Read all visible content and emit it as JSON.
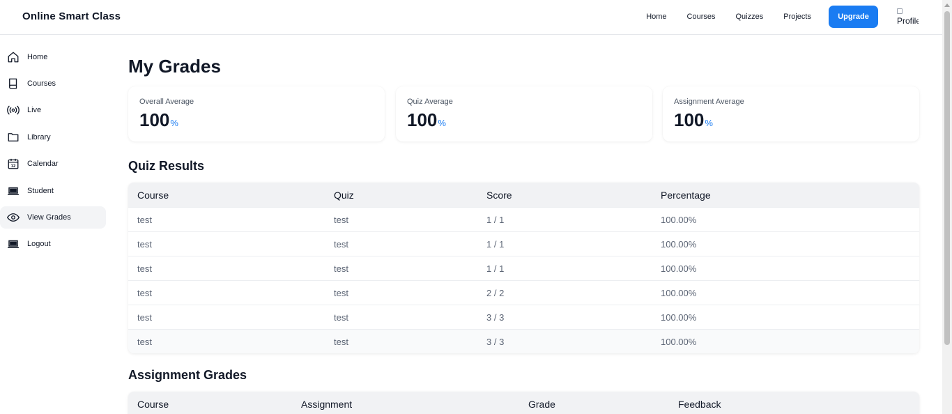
{
  "app": {
    "title": "Online Smart Class"
  },
  "topnav": {
    "links": [
      "Home",
      "Courses",
      "Quizzes",
      "Projects"
    ],
    "upgrade_label": "Upgrade",
    "profile_alt": "Profile"
  },
  "sidebar": {
    "items": [
      {
        "label": "Home",
        "icon": "home-icon"
      },
      {
        "label": "Courses",
        "icon": "book-icon"
      },
      {
        "label": "Live",
        "icon": "broadcast-icon"
      },
      {
        "label": "Library",
        "icon": "folder-icon"
      },
      {
        "label": "Calendar",
        "icon": "calendar-icon"
      },
      {
        "label": "Student",
        "icon": "laptop-icon"
      },
      {
        "label": "View Grades",
        "icon": "eye-icon",
        "active": true
      },
      {
        "label": "Logout",
        "icon": "laptop-icon"
      }
    ],
    "calendar_day": "12"
  },
  "page": {
    "title": "My Grades"
  },
  "stats": [
    {
      "label": "Overall Average",
      "value": "100",
      "unit": "%"
    },
    {
      "label": "Quiz Average",
      "value": "100",
      "unit": "%"
    },
    {
      "label": "Assignment Average",
      "value": "100",
      "unit": "%"
    }
  ],
  "quiz_results": {
    "title": "Quiz Results",
    "columns": [
      "Course",
      "Quiz",
      "Score",
      "Percentage"
    ],
    "rows": [
      [
        "test",
        "test",
        "1 / 1",
        "100.00%"
      ],
      [
        "test",
        "test",
        "1 / 1",
        "100.00%"
      ],
      [
        "test",
        "test",
        "1 / 1",
        "100.00%"
      ],
      [
        "test",
        "test",
        "2 / 2",
        "100.00%"
      ],
      [
        "test",
        "test",
        "3 / 3",
        "100.00%"
      ],
      [
        "test",
        "test",
        "3 / 3",
        "100.00%"
      ]
    ]
  },
  "assignment_grades": {
    "title": "Assignment Grades",
    "columns": [
      "Course",
      "Assignment",
      "Grade",
      "Feedback"
    ]
  },
  "colors": {
    "accent": "#1a7cf2",
    "active_bg": "#f3f4f6",
    "table_header_bg": "#f1f2f4",
    "muted_text": "#5b6474"
  }
}
